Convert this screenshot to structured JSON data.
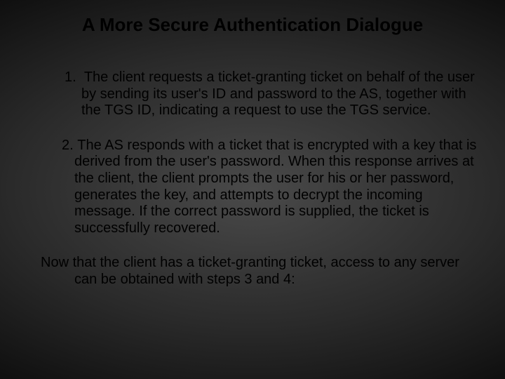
{
  "title": "A More Secure Authentication Dialogue",
  "items": [
    {
      "num": "1.",
      "text": "The client requests a ticket-granting ticket on behalf of the user by sending its user's ID and password to the AS, together with the TGS ID, indicating a request to use the TGS service."
    },
    {
      "num": "2.",
      "text": "The AS responds with a ticket that is encrypted with a key that is derived from the user's password. When this response arrives at the client, the client prompts the user for his or her password, generates the key, and attempts to decrypt the incoming message. If the correct password is supplied, the ticket is successfully recovered."
    }
  ],
  "closing": "Now that the client has a ticket-granting ticket, access to any server can be obtained with steps 3 and 4:"
}
